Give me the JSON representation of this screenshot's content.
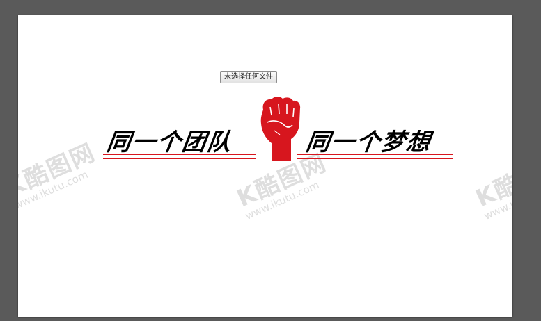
{
  "file_input": {
    "label": "未选择任何文件"
  },
  "banner": {
    "left_slogan": "同一个团队",
    "right_slogan": "同一个梦想",
    "accent_color": "#d7161e",
    "icon": "raised-fist-icon"
  },
  "watermarks": [
    {
      "logo": "K酷图网",
      "url": "www.ikutu.com"
    },
    {
      "logo": "K酷图网",
      "url": "www.ikutu.com"
    },
    {
      "logo": "K酷图网",
      "url": "www.ikutu.com"
    }
  ]
}
